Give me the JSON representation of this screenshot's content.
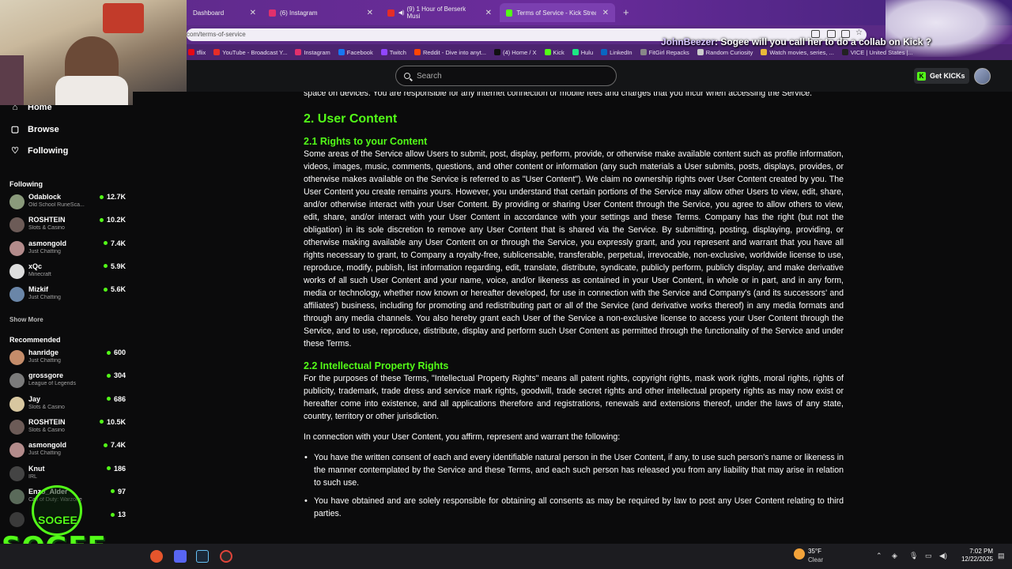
{
  "browser": {
    "tabs": [
      {
        "label": "Dashboard",
        "color": "#9b6ad6"
      },
      {
        "label": "(6) Instagram",
        "color": "#e1306c"
      },
      {
        "label": "(9) 1 Hour of Berserk Musi",
        "color": "#e52d27"
      },
      {
        "label": "Terms of Service - Kick Streami",
        "color": "#53fc18"
      }
    ],
    "new_tab": "+",
    "url": "com/terms-of-service",
    "bookmarks": [
      {
        "label": "tflix",
        "color": "#e50914"
      },
      {
        "label": "YouTube - Broadcast Y...",
        "color": "#e52d27"
      },
      {
        "label": "Instagram",
        "color": "#e1306c"
      },
      {
        "label": "Facebook",
        "color": "#1877f2"
      },
      {
        "label": "Twitch",
        "color": "#9146ff"
      },
      {
        "label": "Reddit - Dive into anyt...",
        "color": "#ff4500"
      },
      {
        "label": "(4) Home / X",
        "color": "#111111"
      },
      {
        "label": "Kick",
        "color": "#53fc18"
      },
      {
        "label": "Hulu",
        "color": "#1ce783"
      },
      {
        "label": "LinkedIn",
        "color": "#0a66c2"
      },
      {
        "label": "FitGirl Repacks",
        "color": "#888888"
      },
      {
        "label": "Random Curiosity",
        "color": "#cccccc"
      },
      {
        "label": "Watch movies, series, ...",
        "color": "#e8b93a"
      },
      {
        "label": "VICE | United States |...",
        "color": "#222222"
      }
    ]
  },
  "chat_overlay": {
    "user": "JohnBeezer",
    "message": ": Sogee will you call her to do a collab on Kick ?"
  },
  "kick": {
    "search_placeholder": "Search",
    "get_kicks_label": "Get KICKs",
    "get_kicks_glyph": "K",
    "accent": "#53fc18"
  },
  "sidebar": {
    "nav": [
      {
        "label": "Home",
        "icon": "home-icon",
        "glyph": "⌂"
      },
      {
        "label": "Browse",
        "icon": "browse-icon",
        "glyph": "▢"
      },
      {
        "label": "Following",
        "icon": "heart-icon",
        "glyph": "♡"
      }
    ],
    "following_title": "Following",
    "following": [
      {
        "name": "Odablock",
        "category": "Old School RuneSca...",
        "viewers": "12.7K",
        "color": "#8a9a7b"
      },
      {
        "name": "ROSHTEIN",
        "category": "Slots & Casino",
        "viewers": "10.2K",
        "color": "#6c5b57"
      },
      {
        "name": "asmongold",
        "category": "Just Chatting",
        "viewers": "7.4K",
        "color": "#b38b8b"
      },
      {
        "name": "xQc",
        "category": "Minecraft",
        "viewers": "5.9K",
        "color": "#dddddd"
      },
      {
        "name": "Mizkif",
        "category": "Just Chatting",
        "viewers": "5.6K",
        "color": "#6a86a8"
      }
    ],
    "show_more": "Show More",
    "recommended_title": "Recommended",
    "recommended": [
      {
        "name": "hanridge",
        "category": "Just Chatting",
        "viewers": "600",
        "color": "#c48c6a"
      },
      {
        "name": "grossgore",
        "category": "League of Legends",
        "viewers": "304",
        "color": "#7b7b7b"
      },
      {
        "name": "Jay",
        "category": "Slots & Casino",
        "viewers": "686",
        "color": "#d8c7a0"
      },
      {
        "name": "ROSHTEIN",
        "category": "Slots & Casino",
        "viewers": "10.5K",
        "color": "#6c5b57"
      },
      {
        "name": "asmongold",
        "category": "Just Chatting",
        "viewers": "7.4K",
        "color": "#b38b8b"
      },
      {
        "name": "Knut",
        "category": "IRL",
        "viewers": "186",
        "color": "#444444"
      },
      {
        "name": "Enzo_Alder",
        "category": "Call of Duty: Warzone",
        "viewers": "97",
        "color": "#5a6a5a"
      },
      {
        "name": "",
        "category": "",
        "viewers": "13",
        "color": "#3a3a3a"
      }
    ]
  },
  "logo": {
    "small": "SOGEE",
    "big": "SOGEE"
  },
  "document": {
    "intro": "space on devices. You are responsible for any internet connection or mobile fees and charges that you incur when accessing the Service.",
    "section_title": "2. User Content",
    "sub1_title": "2.1 Rights to your Content",
    "sub1_body": "Some areas of the Service allow Users to submit, post, display, perform, provide, or otherwise make available content such as profile information, videos, images, music, comments, questions, and other content or information (any such materials a User submits, posts, displays, provides, or otherwise makes available on the Service is referred to as \"User Content\"). We claim no ownership rights over User Content created by you. The User Content you create remains yours. However, you understand that certain portions of the Service may allow other Users to view, edit, share, and/or otherwise interact with your User Content. By providing or sharing User Content through the Service, you agree to allow others to view, edit, share, and/or interact with your User Content in accordance with your settings and these Terms. Company has the right (but not the obligation) in its sole discretion to remove any User Content that is shared via the Service. By submitting, posting, displaying, providing, or otherwise making available any User Content on or through the Service, you expressly grant, and you represent and warrant that you have all rights necessary to grant, to Company a royalty-free, sublicensable, transferable, perpetual, irrevocable, non-exclusive, worldwide license to use, reproduce, modify, publish, list information regarding, edit, translate, distribute, syndicate, publicly perform, publicly display, and make derivative works of all such User Content and your name, voice, and/or likeness as contained in your User Content, in whole or in part, and in any form, media or technology, whether now known or hereafter developed, for use in connection with the Service and Company's (and its successors' and affiliates') business, including for promoting and redistributing part or all of the Service (and derivative works thereof) in any media formats and through any media channels. You also hereby grant each User of the Service a non-exclusive license to access your User Content through the Service, and to use, reproduce, distribute, display and perform such User Content as permitted through the functionality of the Service and under these Terms.",
    "sub2_title": "2.2 Intellectual Property Rights",
    "sub2_body": "For the purposes of these Terms, \"Intellectual Property Rights\" means all patent rights, copyright rights, mask work rights, moral rights, rights of publicity, trademark, trade dress and service mark rights, goodwill, trade secret rights and other intellectual property rights as may now exist or hereafter come into existence, and all applications therefore and registrations, renewals and extensions thereof, under the laws of any state, country, territory or other jurisdiction.",
    "affirm": "In connection with your User Content, you affirm, represent and warrant the following:",
    "bullets": [
      "You have the written consent of each and every identifiable natural person in the User Content, if any, to use such person's name or likeness in the manner contemplated by the Service and these Terms, and each such person has released you from any liability that may arise in relation to such use.",
      "You have obtained and are solely responsible for obtaining all consents as may be required by law to post any User Content relating to third parties."
    ]
  },
  "taskbar": {
    "weather_temp": "35°F",
    "weather_desc": "Clear",
    "time": "7:02 PM",
    "date": "12/22/2025"
  }
}
